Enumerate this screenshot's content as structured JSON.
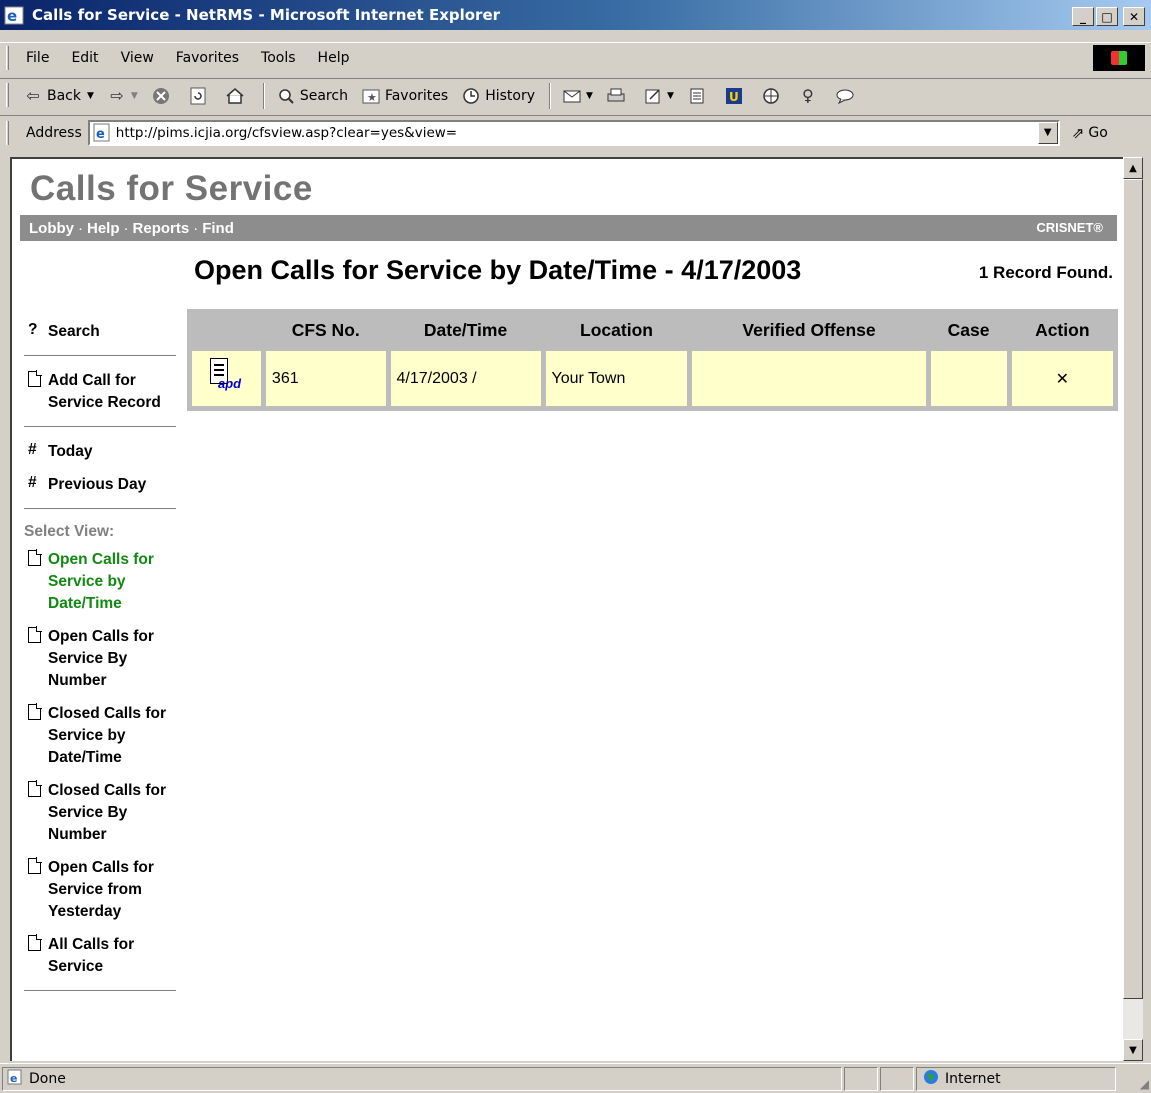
{
  "window": {
    "title": "Calls for Service - NetRMS - Microsoft Internet Explorer",
    "minimize": "_",
    "maximize": "□",
    "close": "✕"
  },
  "menu": {
    "items": [
      "File",
      "Edit",
      "View",
      "Favorites",
      "Tools",
      "Help"
    ]
  },
  "toolbar": {
    "back": "Back",
    "search": "Search",
    "favorites": "Favorites",
    "history": "History"
  },
  "address": {
    "label": "Address",
    "url": "http://pims.icjia.org/cfsview.asp?clear=yes&view=",
    "go": "Go"
  },
  "page": {
    "app_title": "Calls for Service",
    "nav": [
      "Lobby",
      "Help",
      "Reports",
      "Find"
    ],
    "brand": "CRISNET®",
    "heading": "Open Calls for Service by Date/Time - 4/17/2003",
    "records_found": "1 Record Found."
  },
  "sidebar": {
    "search": "Search",
    "add_record": "Add Call for Service Record",
    "today": "Today",
    "previous_day": "Previous Day",
    "select_view_label": "Select View:",
    "views": [
      "Open Calls for Service by Date/Time",
      "Open Calls for Service By Number",
      "Closed Calls for Service by Date/Time",
      "Closed Calls for Service By Number",
      "Open Calls for Service from Yesterday",
      "All Calls for Service"
    ],
    "active_view_color": "#118a11"
  },
  "table": {
    "columns": [
      "",
      "CFS No.",
      "Date/Time",
      "Location",
      "Verified Offense",
      "Case",
      "Action"
    ],
    "rows": [
      {
        "icon_label": "apd",
        "cfs_no": "361",
        "date_time": "4/17/2003 /",
        "location": "Your Town",
        "verified_offense": "",
        "case": "",
        "action": "✕"
      }
    ],
    "row_color": "#ffffcc"
  },
  "status": {
    "text": "Done",
    "zone": "Internet"
  }
}
